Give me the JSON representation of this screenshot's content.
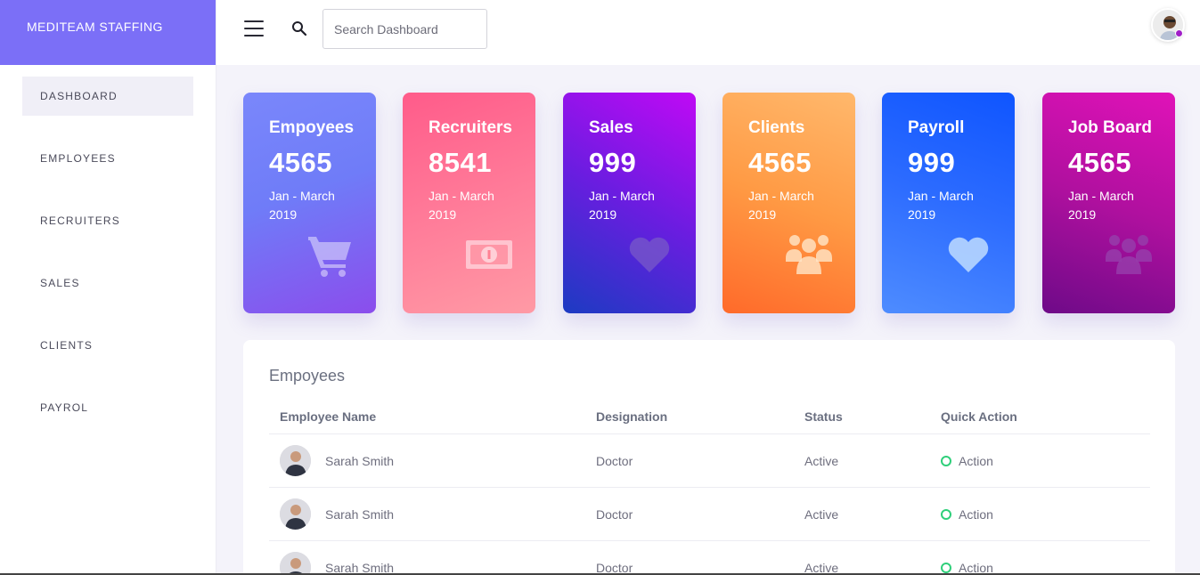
{
  "brand": {
    "name": "MEDITEAM STAFFING"
  },
  "sidebar": {
    "items": [
      {
        "label": "DASHBOARD"
      },
      {
        "label": "EMPLOYEES"
      },
      {
        "label": "RECRUITERS"
      },
      {
        "label": "SALES"
      },
      {
        "label": "CLIENTS"
      },
      {
        "label": "PAYROL"
      }
    ]
  },
  "topbar": {
    "search_placeholder": "Search Dashboard",
    "menu_icon": "hamburger-icon",
    "search_icon": "search-icon"
  },
  "cards": [
    {
      "title": "Empoyees",
      "value": "4565",
      "period": "Jan - March 2019",
      "icon": "cart-icon"
    },
    {
      "title": "Recruiters",
      "value": "8541",
      "period": "Jan - March 2019",
      "icon": "money-icon"
    },
    {
      "title": "Sales",
      "value": "999",
      "period": "Jan - March 2019",
      "icon": "heart-icon"
    },
    {
      "title": "Clients",
      "value": "4565",
      "period": "Jan - March 2019",
      "icon": "users-icon"
    },
    {
      "title": "Payroll",
      "value": "999",
      "period": "Jan - March 2019",
      "icon": "heart-icon"
    },
    {
      "title": "Job Board",
      "value": "4565",
      "period": "Jan - March 2019",
      "icon": "users-icon"
    }
  ],
  "table": {
    "title": "Empoyees",
    "headers": [
      "Employee Name",
      "Designation",
      "Status",
      "Quick Action"
    ],
    "rows": [
      {
        "name": "Sarah Smith",
        "designation": "Doctor",
        "status": "Active",
        "action": "Action"
      },
      {
        "name": "Sarah Smith",
        "designation": "Doctor",
        "status": "Active",
        "action": "Action"
      },
      {
        "name": "Sarah Smith",
        "designation": "Doctor",
        "status": "Active",
        "action": "Action"
      }
    ]
  },
  "colors": {
    "brand": "#7b6ff7",
    "status_active": "#2fcf7a",
    "avatar_dot": "#a01ec8"
  }
}
